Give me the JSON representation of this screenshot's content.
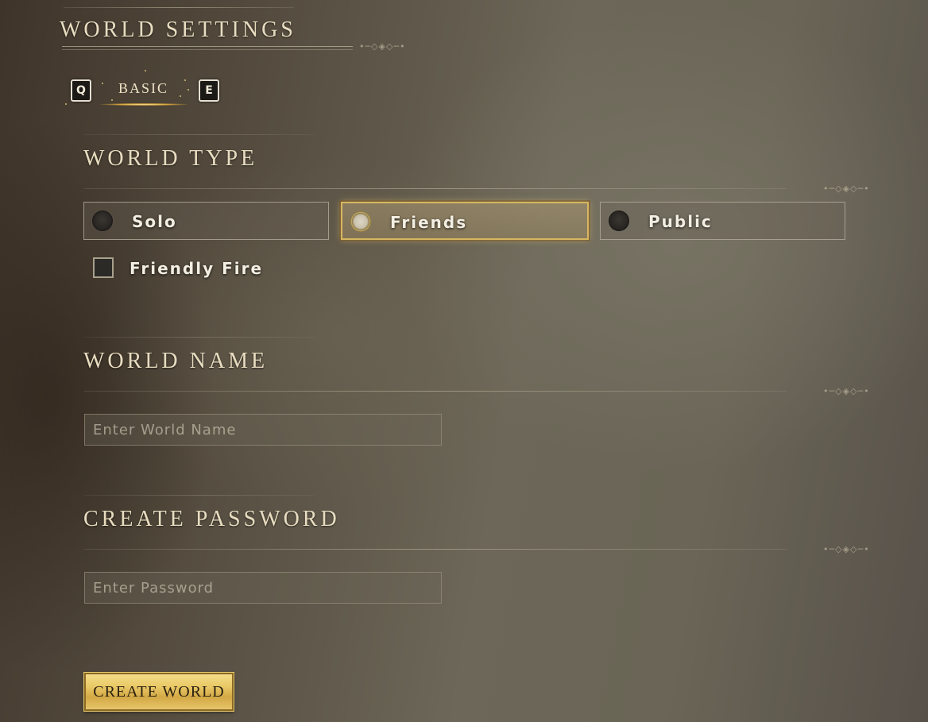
{
  "panel": {
    "title": "WORLD SETTINGS"
  },
  "tabs": {
    "prev_key": "Q",
    "next_key": "E",
    "active_label": "BASIC"
  },
  "world_type": {
    "heading": "WORLD TYPE",
    "options": [
      {
        "label": "Solo",
        "selected": false
      },
      {
        "label": "Friends",
        "selected": true
      },
      {
        "label": "Public",
        "selected": false
      }
    ],
    "friendly_fire": {
      "label": "Friendly Fire",
      "checked": false
    }
  },
  "world_name": {
    "heading": "WORLD NAME",
    "placeholder": "Enter World Name",
    "value": ""
  },
  "password": {
    "heading": "CREATE PASSWORD",
    "placeholder": "Enter Password",
    "value": ""
  },
  "actions": {
    "create_label": "CREATE WORLD"
  },
  "colors": {
    "accent_gold": "#d7b660",
    "text_light": "#f3eee2",
    "heading": "#e8dcc0"
  }
}
